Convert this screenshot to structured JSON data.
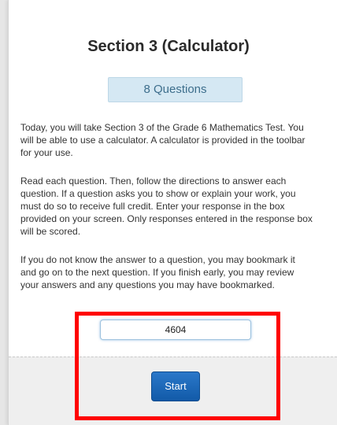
{
  "section": {
    "title": "Section 3 (Calculator)",
    "questions_badge": "8 Questions"
  },
  "instructions": [
    "Today, you will take Section 3 of the Grade 6 Mathematics Test. You will be able to use a calculator. A calculator is provided in the toolbar for your use.",
    "Read each question. Then, follow the directions to answer each question. If a question asks you to show or explain your work, you must do so to receive full credit. Enter your response in the box provided on your screen. Only responses entered in the response box will be scored.",
    "If you do not know the answer to a question, you may bookmark it and go on to the next question. If you finish early, you may review your answers and any questions you may have bookmarked."
  ],
  "code_input": {
    "value": "4604"
  },
  "start_button": {
    "label": "Start"
  },
  "colors": {
    "badge_bg": "#d5e8f3",
    "button_blue": "#1a66b8",
    "highlight_red": "#ff0000"
  }
}
